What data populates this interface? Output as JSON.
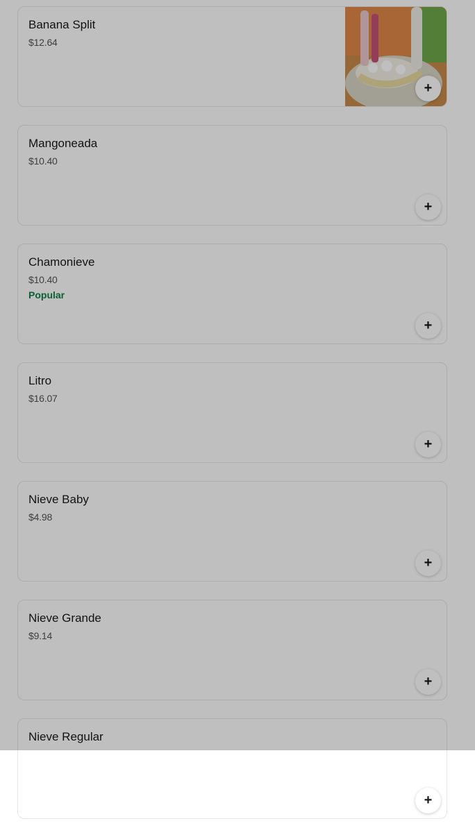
{
  "menu": {
    "items": [
      {
        "name": "Banana Split",
        "price": "$12.64",
        "badge": "",
        "has_image": true,
        "add_icon": "plus-icon"
      },
      {
        "name": "Mangoneada",
        "price": "$10.40",
        "badge": "",
        "has_image": false,
        "add_icon": "plus-icon"
      },
      {
        "name": "Chamonieve",
        "price": "$10.40",
        "badge": "Popular",
        "has_image": false,
        "add_icon": "plus-icon"
      },
      {
        "name": "Litro",
        "price": "$16.07",
        "badge": "",
        "has_image": false,
        "add_icon": "plus-icon"
      },
      {
        "name": "Nieve Baby",
        "price": "$4.98",
        "badge": "",
        "has_image": false,
        "add_icon": "plus-icon"
      },
      {
        "name": "Nieve Grande",
        "price": "$9.14",
        "badge": "",
        "has_image": false,
        "add_icon": "plus-icon"
      },
      {
        "name": "Nieve Regular",
        "price": "",
        "badge": "",
        "has_image": false,
        "add_icon": "plus-icon"
      }
    ],
    "add_symbol": "+"
  },
  "colors": {
    "badge": "#0e8345",
    "scrim": "rgba(0,0,0,0.25)",
    "card_border": "#e6e6e6"
  }
}
